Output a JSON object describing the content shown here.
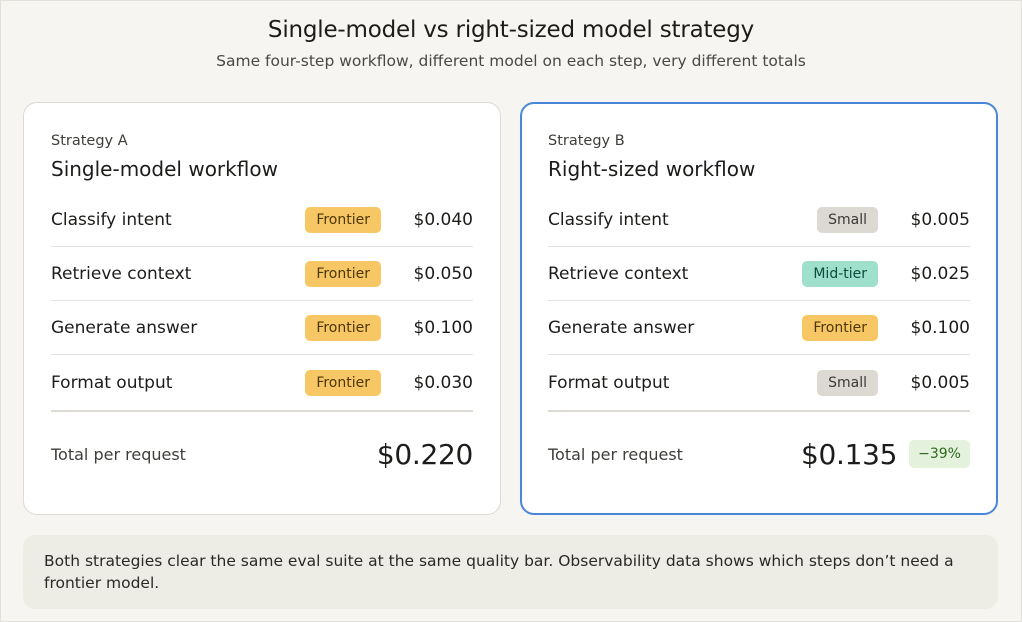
{
  "header": {
    "title": "Single-model vs right-sized model strategy",
    "subtitle": "Same four-step workflow, different model on each step, very different totals"
  },
  "strategy_a": {
    "kicker": "Strategy A",
    "title": "Single-model workflow",
    "rows": [
      {
        "step": "Classify intent",
        "tier": "Frontier",
        "cost": "$0.040"
      },
      {
        "step": "Retrieve context",
        "tier": "Frontier",
        "cost": "$0.050"
      },
      {
        "step": "Generate answer",
        "tier": "Frontier",
        "cost": "$0.100"
      },
      {
        "step": "Format output",
        "tier": "Frontier",
        "cost": "$0.030"
      }
    ],
    "total_label": "Total per request",
    "total_value": "$0.220"
  },
  "strategy_b": {
    "kicker": "Strategy B",
    "title": "Right-sized workflow",
    "rows": [
      {
        "step": "Classify intent",
        "tier": "Small",
        "cost": "$0.005"
      },
      {
        "step": "Retrieve context",
        "tier": "Mid-tier",
        "cost": "$0.025"
      },
      {
        "step": "Generate answer",
        "tier": "Frontier",
        "cost": "$0.100"
      },
      {
        "step": "Format output",
        "tier": "Small",
        "cost": "$0.005"
      }
    ],
    "total_label": "Total per request",
    "total_value": "$0.135",
    "savings_badge": "−39%"
  },
  "note": {
    "text": "Both strategies clear the same eval suite at the same quality bar. Observability data shows which steps don’t need a frontier model."
  },
  "colors": {
    "frontier_pill": "#f8c765",
    "small_pill": "#dbd9d2",
    "mid_tier_pill": "#9ee0cc",
    "highlight_border": "#4a86d8",
    "savings_badge": "#e4f1dc"
  }
}
